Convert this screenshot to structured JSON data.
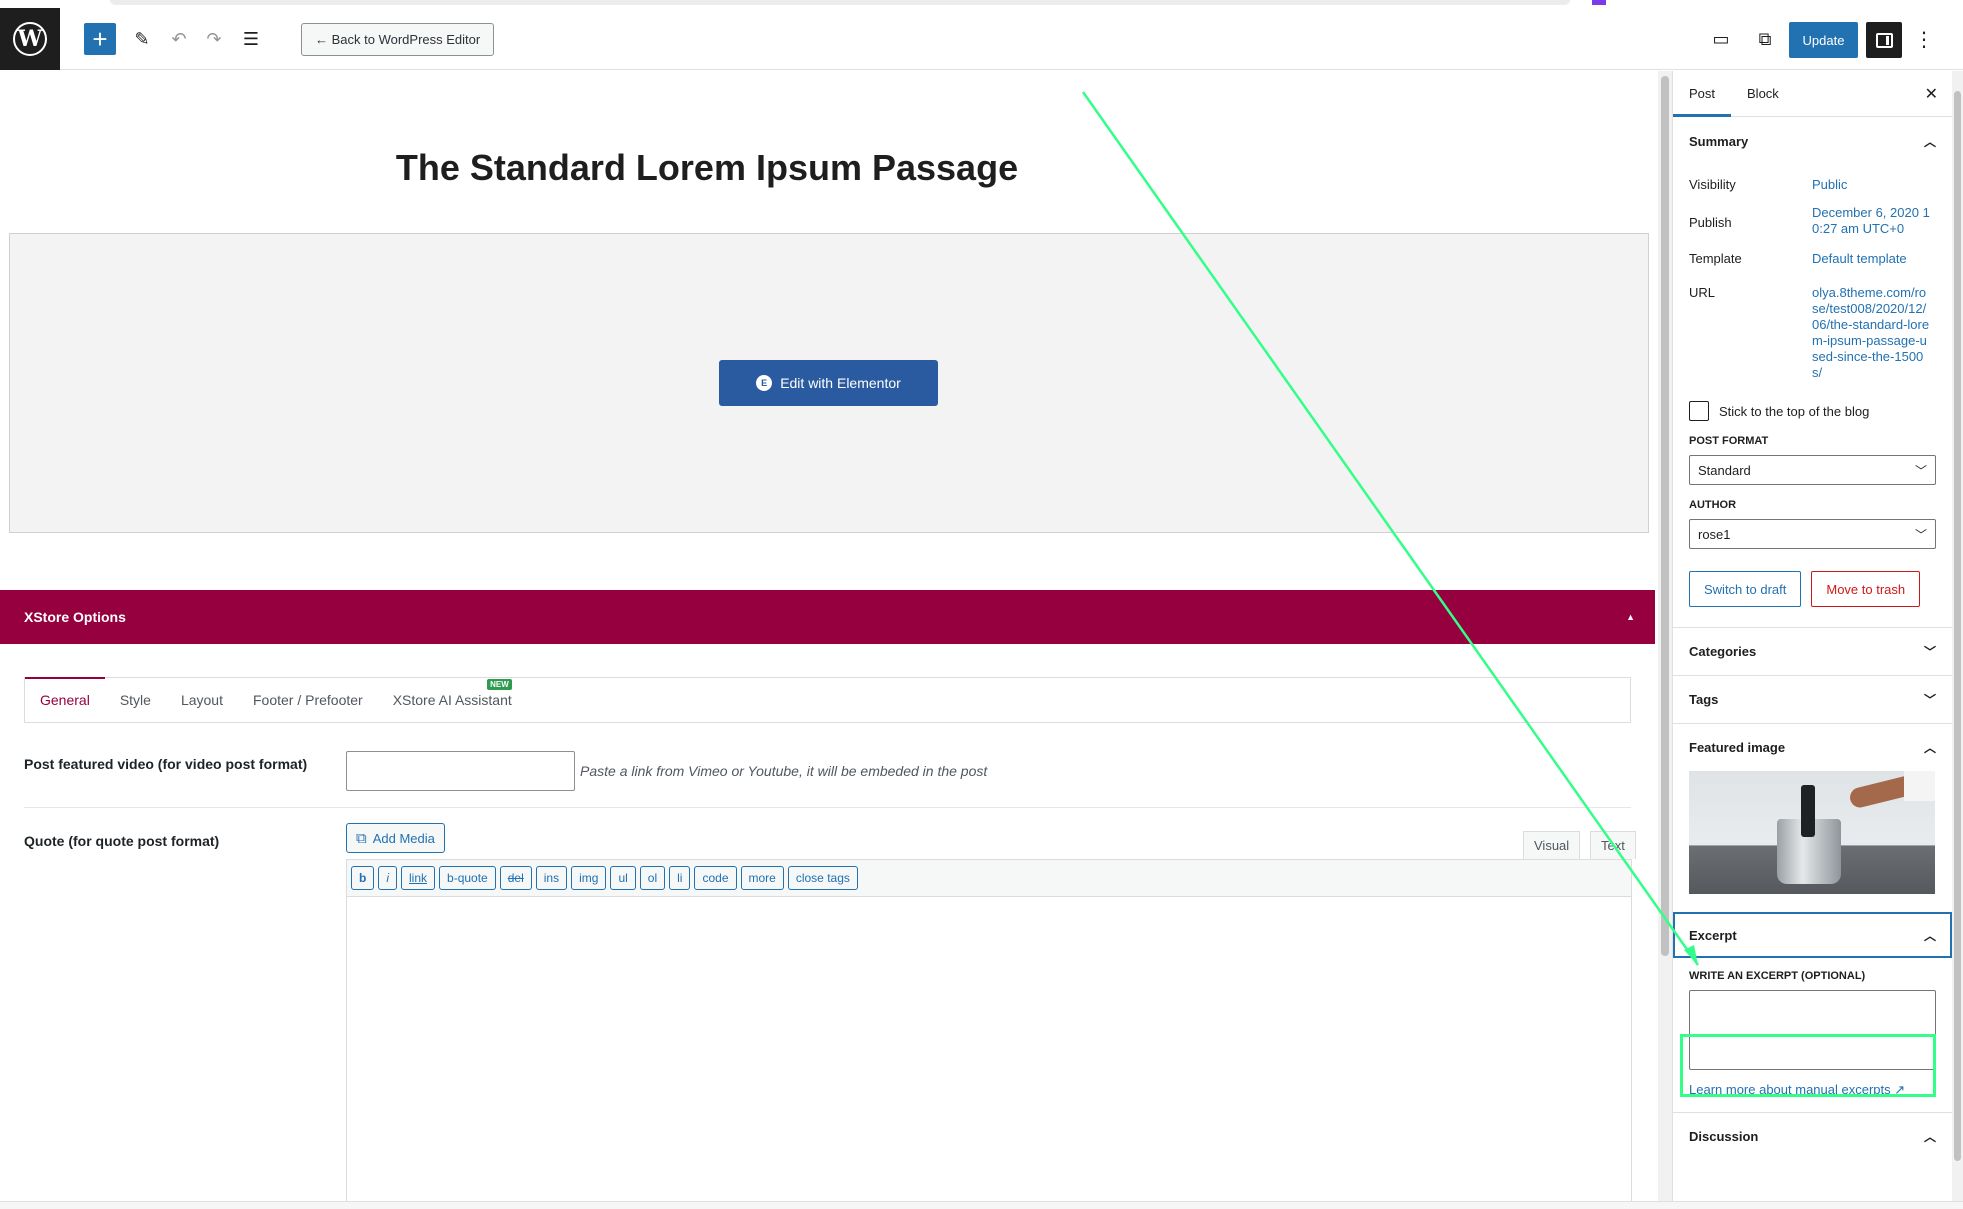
{
  "toolbar": {
    "back_label": "← Back to WordPress Editor",
    "update_label": "Update",
    "icons": {
      "logo": "wordpress-logo-icon",
      "add": "plus-icon",
      "tools": "pencil-icon",
      "undo": "undo-icon",
      "redo": "redo-icon",
      "outline": "list-view-icon",
      "preview": "laptop-icon",
      "view": "external-link-icon",
      "settings": "sidebar-panel-icon",
      "options": "vertical-ellipsis-icon"
    }
  },
  "editor": {
    "post_title": "The Standard Lorem Ipsum Passage",
    "elementor_button": "Edit with Elementor"
  },
  "xstore": {
    "header": "XStore Options",
    "tabs": [
      "General",
      "Style",
      "Layout",
      "Footer / Prefooter",
      "XStore AI Assistant"
    ],
    "active_tab": "General",
    "new_badge": "NEW",
    "video_label": "Post featured video (for video post format)",
    "video_hint": "Paste a link from Vimeo or Youtube, it will be embeded in the post",
    "quote_label": "Quote (for quote post format)",
    "add_media": "Add Media",
    "mode_visual": "Visual",
    "mode_text": "Text",
    "quicktags": [
      "b",
      "i",
      "link",
      "b-quote",
      "del",
      "ins",
      "img",
      "ul",
      "ol",
      "li",
      "code",
      "more",
      "close tags"
    ]
  },
  "sidebar": {
    "tabs": [
      "Post",
      "Block"
    ],
    "active_tab": "Post",
    "summary": {
      "title": "Summary",
      "visibility_label": "Visibility",
      "visibility_value": "Public",
      "publish_label": "Publish",
      "publish_value": "December 6, 2020 10:27 am UTC+0",
      "template_label": "Template",
      "template_value": "Default template",
      "url_label": "URL",
      "url_value": "olya.8theme.com/rose/test008/2020/12/06/the-standard-lorem-ipsum-passage-used-since-the-1500s/",
      "sticky_label": "Stick to the top of the blog",
      "sticky_checked": false,
      "post_format_label": "POST FORMAT",
      "post_format_value": "Standard",
      "author_label": "AUTHOR",
      "author_value": "rose1",
      "switch_draft": "Switch to draft",
      "move_trash": "Move to trash"
    },
    "categories": "Categories",
    "tags": "Tags",
    "featured_image": "Featured image",
    "excerpt": {
      "title": "Excerpt",
      "label": "WRITE AN EXCERPT (OPTIONAL)",
      "value": "",
      "learn_more": "Learn more about manual excerpts ↗"
    },
    "discussion": "Discussion"
  },
  "colors": {
    "wp_blue": "#2271b1",
    "xstore_header": "#96003f",
    "elementor_blue": "#2a5aa0",
    "annotation_green": "#33ff88"
  }
}
